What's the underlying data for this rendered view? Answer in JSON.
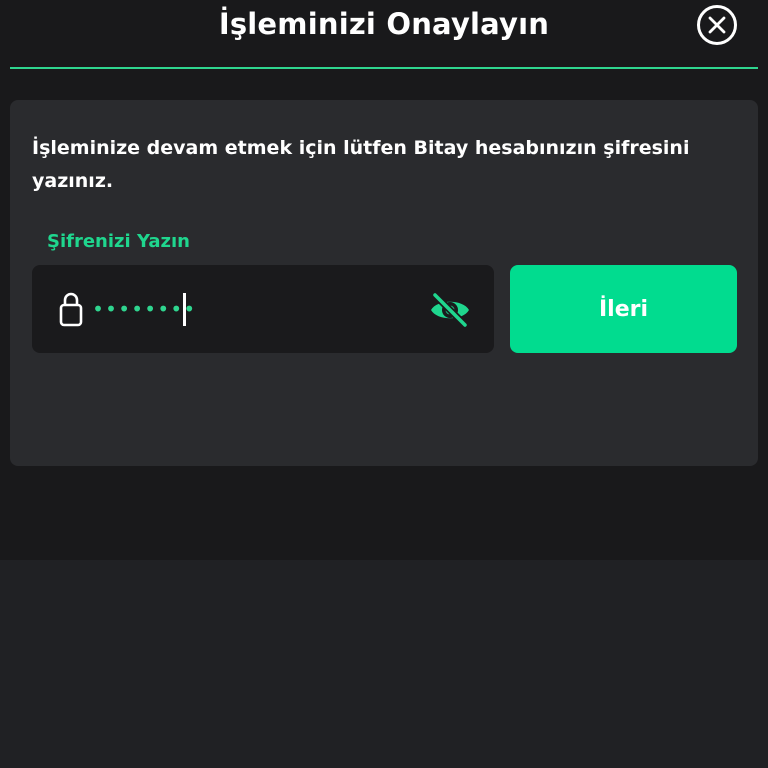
{
  "header": {
    "title": "İşleminizi Onaylayın",
    "close_icon": "close-circle-icon"
  },
  "card": {
    "description": "İşleminize devam etmek için lütfen Bitay hesabınızın şifresini yazınız.",
    "password": {
      "label": "Şifrenizi Yazın",
      "masked_value": "••••••••",
      "lock_icon": "lock-icon",
      "toggle_icon": "eye-off-icon"
    },
    "next_button_label": "İleri"
  },
  "colors": {
    "accent": "#01dc8f",
    "label_green": "#1fd68e",
    "modal_bg": "#19191b",
    "card_bg": "#2a2b2e",
    "input_bg": "#1a1a1c",
    "page_bg": "#202124"
  }
}
